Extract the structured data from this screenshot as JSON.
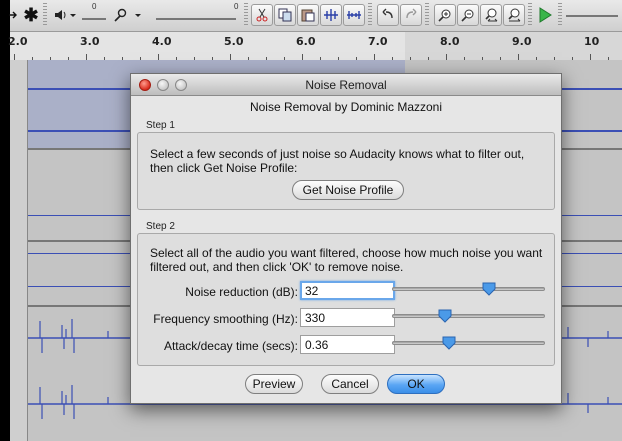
{
  "ruler": {
    "labels": [
      "2.0",
      "3.0",
      "4.0",
      "5.0",
      "6.0",
      "7.0",
      "8.0",
      "9.0",
      "10"
    ]
  },
  "toolbar": {
    "meter_scale_a": "0",
    "meter_scale_b": "0",
    "tools": [
      "multi-tool-icon",
      "speaker-icon",
      "microphone-icon",
      "cut-icon",
      "copy-icon",
      "paste-icon",
      "trim-icon",
      "silence-icon",
      "undo-icon",
      "redo-icon",
      "zoom-in-icon",
      "zoom-out-icon",
      "fit-selection-icon",
      "fit-project-icon",
      "play-icon"
    ]
  },
  "dialog": {
    "window_title": "Noise Removal",
    "heading": "Noise Removal by Dominic Mazzoni",
    "step1": {
      "label": "Step 1",
      "text": "Select a few seconds of just noise so Audacity knows what to filter out, then click Get Noise Profile:",
      "button": "Get Noise Profile"
    },
    "step2": {
      "label": "Step 2",
      "text": "Select all of the audio you want filtered, choose how much noise you want filtered out, and then click 'OK' to remove noise.",
      "fields": [
        {
          "label": "Noise reduction (dB):",
          "value": "32",
          "slider_fraction": 0.65
        },
        {
          "label": "Frequency smoothing (Hz):",
          "value": "330",
          "slider_fraction": 0.33
        },
        {
          "label": "Attack/decay time (secs):",
          "value": "0.36",
          "slider_fraction": 0.36
        }
      ]
    },
    "buttons": {
      "preview": "Preview",
      "cancel": "Cancel",
      "ok": "OK"
    }
  },
  "colors": {
    "waveform": "#3b4fb5",
    "selection": "#aab0c8",
    "default_button": "#5aa6f4",
    "close_button": "#d92b1d"
  }
}
